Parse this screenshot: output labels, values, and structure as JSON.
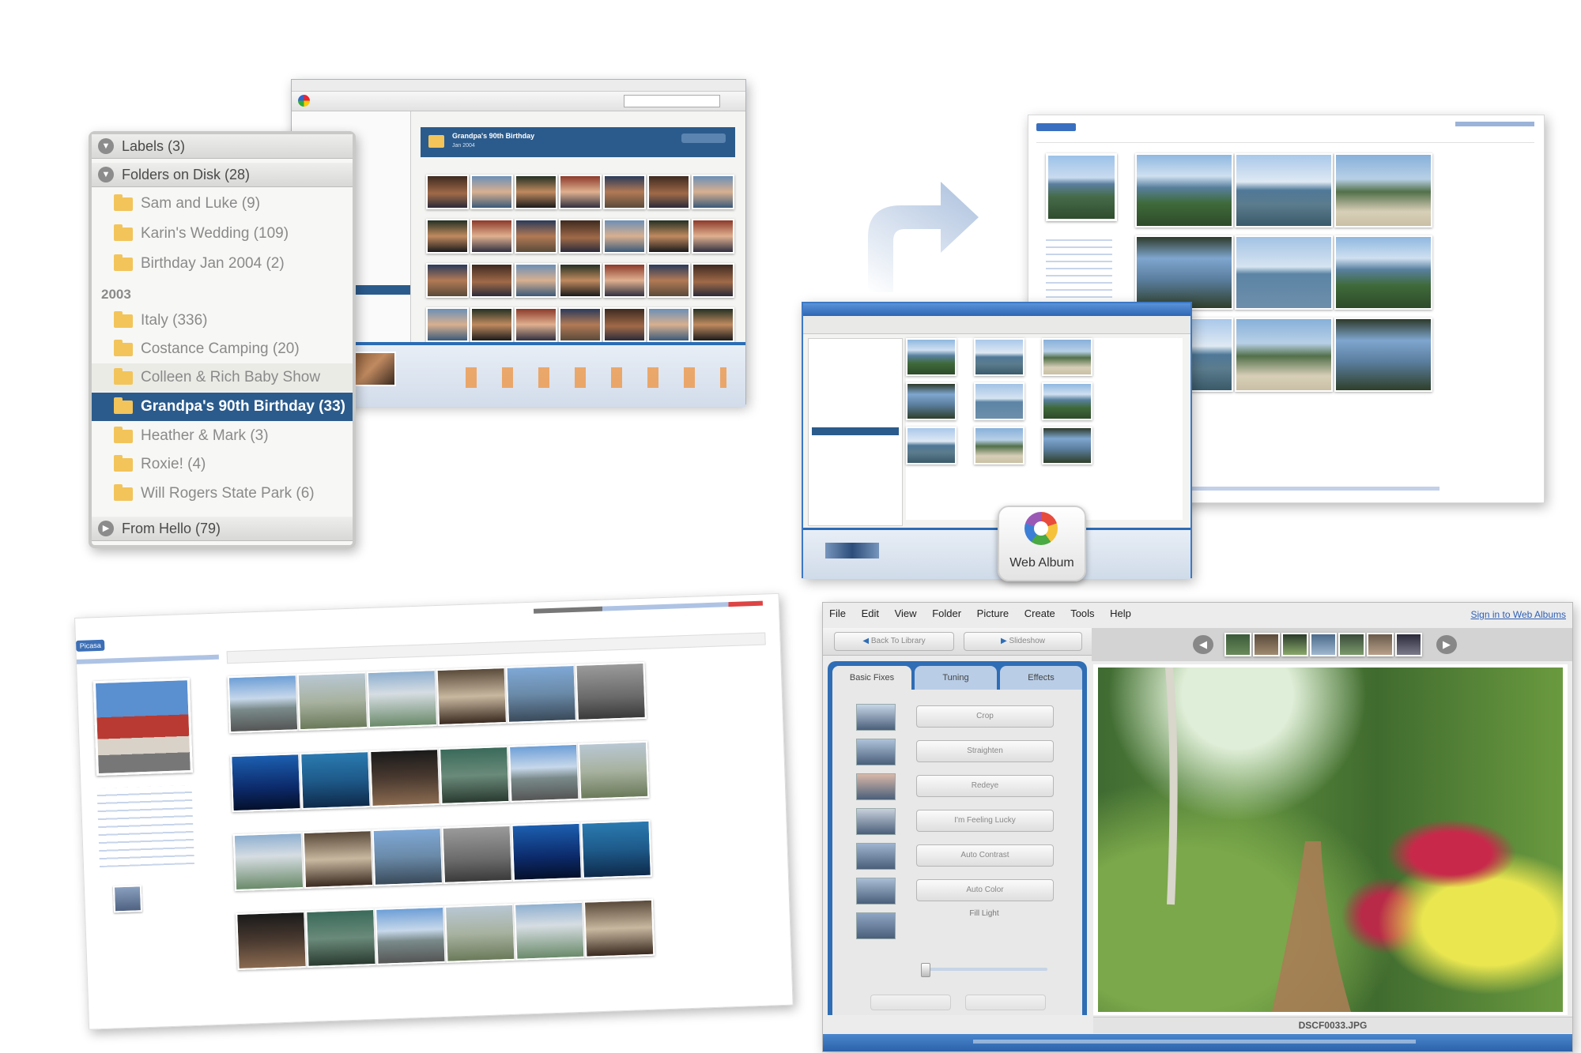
{
  "labels_panel": {
    "sections": [
      {
        "label": "Labels (3)"
      },
      {
        "label": "Folders on Disk (28)"
      },
      {
        "label": "From Hello (79)"
      }
    ],
    "folders": [
      {
        "label": "Sam and Luke (9)"
      },
      {
        "label": "Karin's Wedding (109)"
      },
      {
        "label": "Birthday Jan 2004 (2)"
      },
      {
        "label": "Italy (336)"
      },
      {
        "label": "Costance Camping (20)"
      },
      {
        "label": "Colleen & Rich Baby Show"
      },
      {
        "label": "Grandpa's 90th Birthday (33)"
      },
      {
        "label": "Heather & Mark (3)"
      },
      {
        "label": "Roxie! (4)"
      },
      {
        "label": "Will Rogers State Park (6)"
      }
    ],
    "year": "2003"
  },
  "library_window": {
    "album_title": "Grandpa's 90th Birthday",
    "album_sub": "Jan 2004"
  },
  "web_albums_badge": {
    "label": "Web Album"
  },
  "editor": {
    "menu": [
      "File",
      "Edit",
      "View",
      "Folder",
      "Picture",
      "Create",
      "Tools",
      "Help"
    ],
    "sign_in": "Sign in to Web Albums",
    "back_button": "Back To Library",
    "slideshow_button": "Slideshow",
    "tabs": [
      "Basic Fixes",
      "Tuning",
      "Effects"
    ],
    "tools": [
      "Crop",
      "Straighten",
      "Redeye",
      "I'm Feeling Lucky",
      "Auto Contrast",
      "Auto Color",
      "Fill Light"
    ],
    "filename": "DSCF0033.JPG",
    "colors": {
      "accent": "#2f6db5",
      "panel": "#ececec"
    }
  },
  "web_page_bottom": {
    "logo": "Picasa"
  }
}
